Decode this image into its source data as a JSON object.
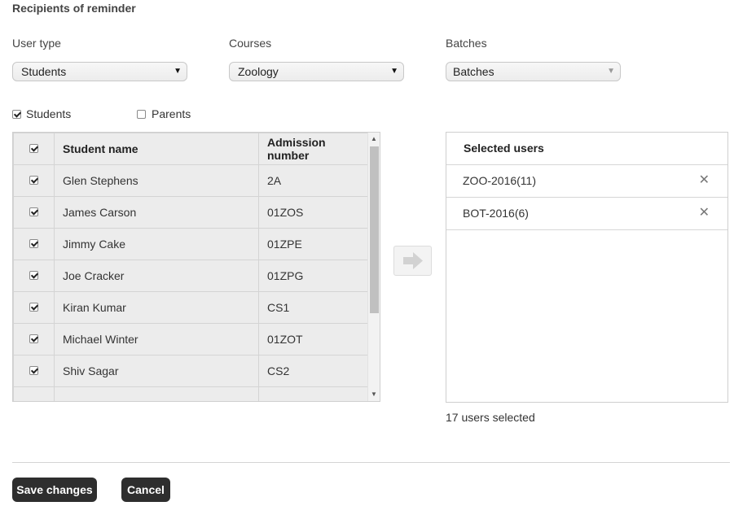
{
  "section_title": "Recipients of reminder",
  "filters": {
    "user_type": {
      "label": "User type",
      "value": "Students"
    },
    "courses": {
      "label": "Courses",
      "value": "Zoology"
    },
    "batches": {
      "label": "Batches",
      "value": "Batches"
    }
  },
  "toggles": {
    "students": {
      "label": "Students",
      "checked": true
    },
    "parents": {
      "label": "Parents",
      "checked": false
    }
  },
  "students_table": {
    "columns": [
      "Student name",
      "Admission number"
    ],
    "rows": [
      {
        "name": "Glen Stephens",
        "admission": "2A",
        "checked": true
      },
      {
        "name": "James Carson",
        "admission": "01ZOS",
        "checked": true
      },
      {
        "name": "Jimmy Cake",
        "admission": "01ZPE",
        "checked": true
      },
      {
        "name": "Joe Cracker",
        "admission": "01ZPG",
        "checked": true
      },
      {
        "name": "Kiran Kumar",
        "admission": "CS1",
        "checked": true
      },
      {
        "name": "Michael Winter",
        "admission": "01ZOT",
        "checked": true
      },
      {
        "name": "Shiv Sagar",
        "admission": "CS2",
        "checked": true
      }
    ]
  },
  "selected_users": {
    "header": "Selected users",
    "items": [
      "ZOO-2016(11)",
      "BOT-2016(6)"
    ],
    "count_text": "17 users selected"
  },
  "actions": {
    "save": "Save changes",
    "cancel": "Cancel"
  },
  "icons": {
    "move": "right-arrow-icon",
    "remove": "close-icon",
    "dropdown": "caret-down-icon"
  },
  "colors": {
    "button_bg": "#2e2e2e",
    "table_bg": "#ececec"
  }
}
